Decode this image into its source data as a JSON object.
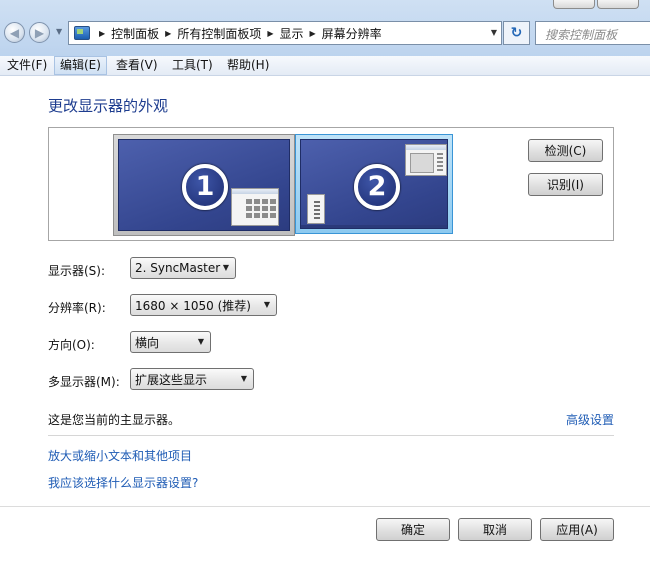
{
  "colors": {
    "frame": "#c5daf1",
    "title": "#1e3d8f",
    "link": "#1f5cb5",
    "screen": "#3d50a0",
    "selected_border": "#3a95d6"
  },
  "toolbar": {
    "back_icon": "back-arrow-icon",
    "forward_icon": "forward-arrow-icon",
    "breadcrumbs": [
      "控制面板",
      "所有控制面板项",
      "显示",
      "屏幕分辨率"
    ],
    "search_placeholder": "搜索控制面板",
    "refresh_icon": "refresh-icon"
  },
  "menu": [
    "文件(F)",
    "编辑(E)",
    "查看(V)",
    "工具(T)",
    "帮助(H)"
  ],
  "page": {
    "title": "更改显示器的外观"
  },
  "monitors": [
    {
      "number": "1",
      "selected": false
    },
    {
      "number": "2",
      "selected": true
    }
  ],
  "side_buttons": {
    "detect": "检测(C)",
    "identify": "识别(I)"
  },
  "settings": {
    "display_label": "显示器(S):",
    "display_value": "2. SyncMaster",
    "resolution_label": "分辨率(R):",
    "resolution_value": "1680 × 1050 (推荐)",
    "orientation_label": "方向(O):",
    "orientation_value": "横向",
    "multi_label": "多显示器(M):",
    "multi_value": "扩展这些显示"
  },
  "info": {
    "primary_text": "这是您当前的主显示器。",
    "advanced_link": "高级设置"
  },
  "links": {
    "text_size": "放大或缩小文本和其他项目",
    "which_settings": "我应该选择什么显示器设置?"
  },
  "footer": {
    "ok": "确定",
    "cancel": "取消",
    "apply": "应用(A)"
  }
}
